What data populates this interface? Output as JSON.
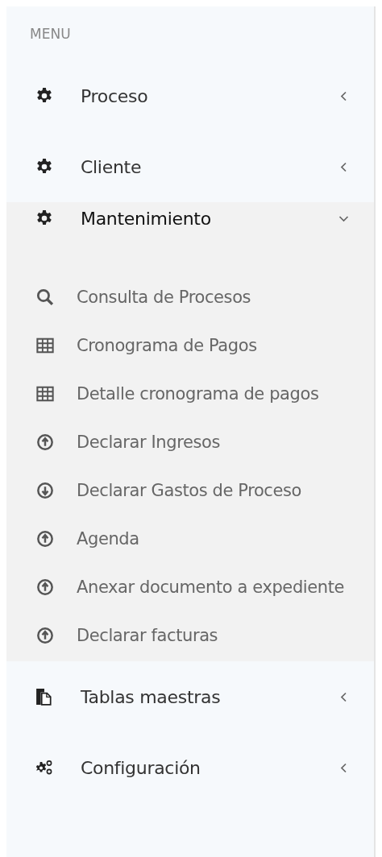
{
  "menu_header": "MENU",
  "items": [
    {
      "label": "Proceso",
      "kind": "gear",
      "expanded": false
    },
    {
      "label": "Cliente",
      "kind": "gear",
      "expanded": false
    },
    {
      "label": "Mantenimiento",
      "kind": "gear",
      "expanded": true,
      "children": [
        {
          "label": "Consulta de Procesos",
          "kind": "search"
        },
        {
          "label": "Cronograma de Pagos",
          "kind": "table"
        },
        {
          "label": "Detalle cronograma de pagos",
          "kind": "table"
        },
        {
          "label": "Declarar Ingresos",
          "kind": "upload"
        },
        {
          "label": "Declarar Gastos de Proceso",
          "kind": "download"
        },
        {
          "label": "Agenda",
          "kind": "upload"
        },
        {
          "label": "Anexar documento a expediente",
          "kind": "upload"
        },
        {
          "label": "Declarar facturas",
          "kind": "upload"
        }
      ]
    },
    {
      "label": "Tablas maestras",
      "kind": "documents",
      "expanded": false
    },
    {
      "label": "Configuración",
      "kind": "gears",
      "expanded": false
    }
  ]
}
